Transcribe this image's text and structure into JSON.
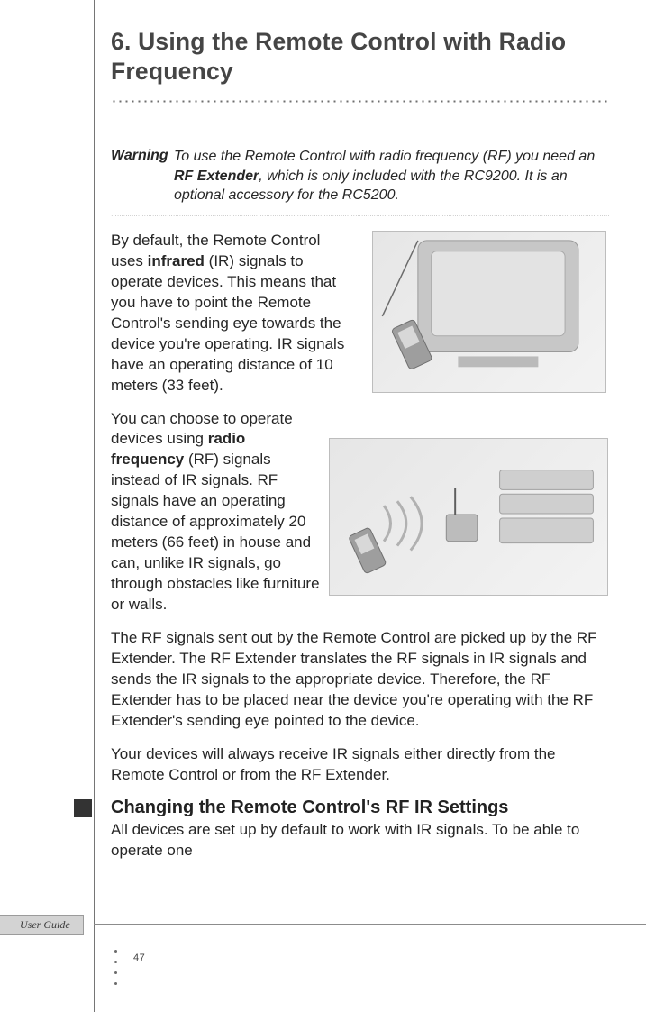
{
  "section_title": "6. Using the Remote Control with Radio Frequency",
  "warning": {
    "label": "Warning",
    "text_before": "To use the Remote Control with radio frequency (RF) you need an ",
    "strong": "RF Extender",
    "text_after": ", which is only included with the RC9200. It is an optional accessory for the RC5200."
  },
  "paragraphs": {
    "p1_before": "By default, the Remote Control uses ",
    "p1_strong": "infrared",
    "p1_after": " (IR) signals to operate devices. This means that you have to point the Remote Control's sending eye towards the device you're operating. IR signals have an operating distance of 10 meters (33 feet).",
    "p2_before": "You can choose to operate devices using ",
    "p2_strong": "radio frequency",
    "p2_after_narrow": " (RF) signals instead of IR signals. RF signals have an operating distance of approximately 20 meters (66 feet) in house and can, unlike IR signals, go through obstacles like furniture or walls.",
    "p3": "The RF signals sent out by the Remote Control are picked up by the RF Extender. The RF Extender translates the RF signals in IR signals and sends the IR signals to the appropriate device. Therefore, the RF Extender has to be placed near the device you're operating with the RF Extender's sending eye pointed to the device.",
    "p4": "Your devices will always receive IR signals either directly from the Remote Control or from the RF Extender."
  },
  "subhead": "Changing the Remote Control's RF IR Settings",
  "sub_p": "All devices are set up by default to work with IR signals. To be able to operate one",
  "footer_label": "User Guide",
  "page_number": "47"
}
